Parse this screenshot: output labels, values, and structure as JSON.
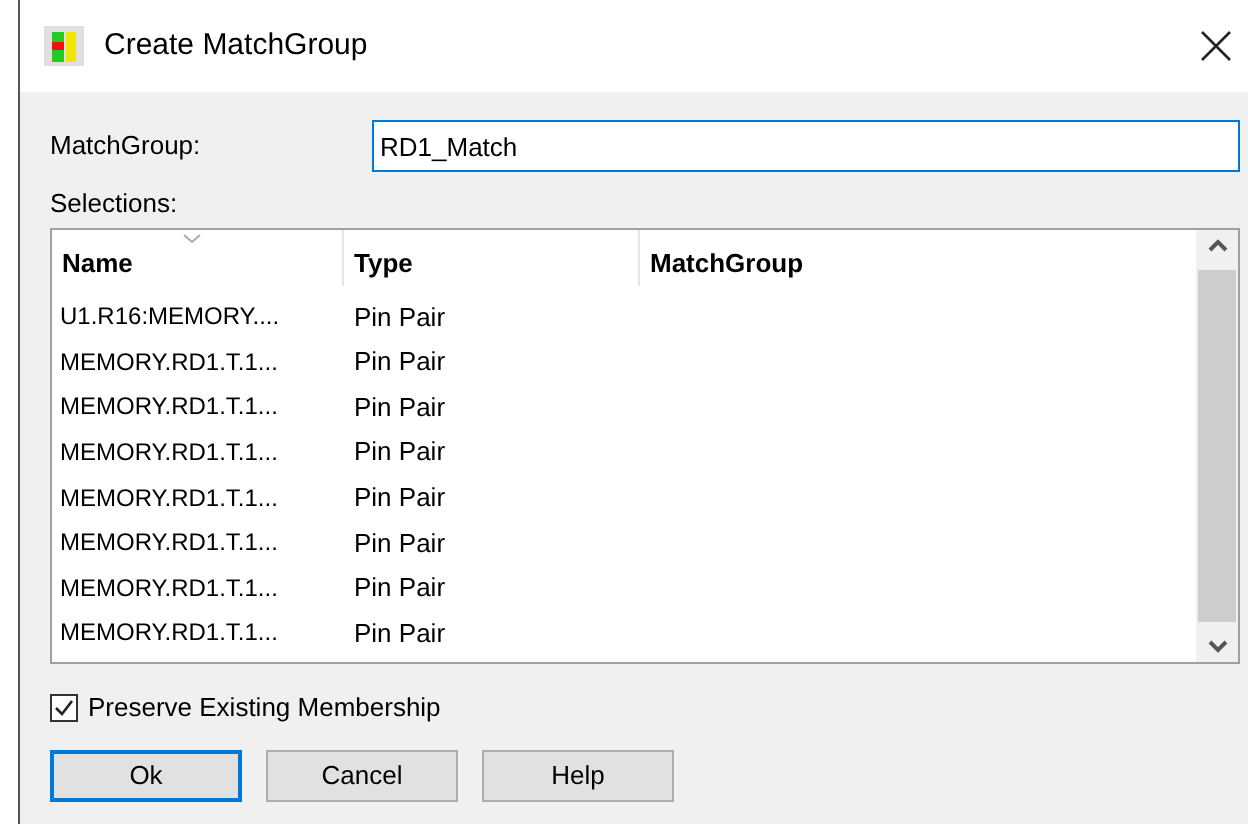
{
  "window": {
    "title": "Create MatchGroup"
  },
  "matchgroup_field": {
    "label": "MatchGroup:",
    "value": "RD1_Match"
  },
  "selections": {
    "label": "Selections:",
    "columns": [
      "Name",
      "Type",
      "MatchGroup"
    ],
    "rows": [
      {
        "name": "U1.R16:MEMORY....",
        "type": "Pin Pair"
      },
      {
        "name": "MEMORY.RD1.T.1...",
        "type": "Pin Pair"
      },
      {
        "name": "MEMORY.RD1.T.1...",
        "type": "Pin Pair"
      },
      {
        "name": "MEMORY.RD1.T.1...",
        "type": "Pin Pair"
      },
      {
        "name": "MEMORY.RD1.T.1...",
        "type": "Pin Pair"
      },
      {
        "name": "MEMORY.RD1.T.1...",
        "type": "Pin Pair"
      },
      {
        "name": "MEMORY.RD1.T.1...",
        "type": "Pin Pair"
      },
      {
        "name": "MEMORY.RD1.T.1...",
        "type": "Pin Pair"
      }
    ]
  },
  "preserve_membership": {
    "label": "Preserve Existing Membership",
    "checked": true
  },
  "buttons": [
    {
      "label": "Ok",
      "selected": true
    },
    {
      "label": "Cancel",
      "selected": false
    },
    {
      "label": "Help",
      "selected": false
    }
  ]
}
